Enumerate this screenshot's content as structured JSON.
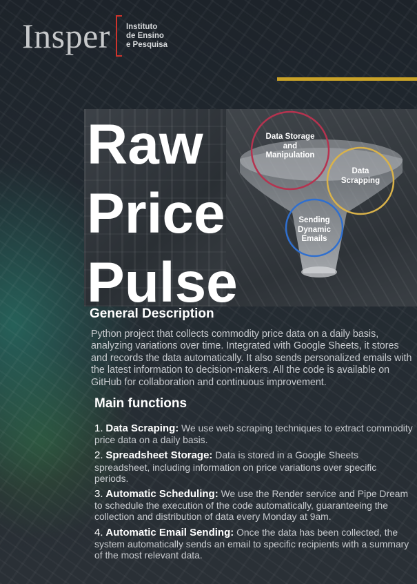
{
  "logo": {
    "wordmark": "Insper",
    "subtitle_line1": "Instituto",
    "subtitle_line2": "de Ensino",
    "subtitle_line3": "e Pesquisa"
  },
  "title": {
    "line1": "Raw",
    "line2": "Price",
    "line3": "Pulse"
  },
  "diagram": {
    "circle1": {
      "line1": "Data Storage",
      "line2": "and",
      "line3": "Manipulation",
      "color": "#b5334f"
    },
    "circle2": {
      "line1": "Data",
      "line2": "Scrapping",
      "color": "#d9b24a"
    },
    "circle3": {
      "line1": "Sending",
      "line2": "Dynamic",
      "line3": "Emails",
      "color": "#2f6fcf"
    }
  },
  "general": {
    "heading": "General Description",
    "line1": "Python project that collects commodity price data on a daily basis,",
    "line2": "analyzing variations over time. Integrated with Google Sheets, it stores",
    "line3": "and records the data automatically. It also sends personalized emails with",
    "line4": "the latest information to decision-makers. All the code is available on",
    "line5": "GitHub for collaboration and continuous improvement."
  },
  "main_functions": {
    "heading": "Main functions",
    "items": [
      {
        "number": "1.",
        "name": "Data Scraping:",
        "text": "We use web scraping techniques to extract commodity price data on a daily basis."
      },
      {
        "number": "2.",
        "name": "Spreadsheet Storage:",
        "text": "Data is stored in a Google Sheets spreadsheet, including information on price variations over specific periods."
      },
      {
        "number": "3.",
        "name": "Automatic Scheduling:",
        "text": "We use the Render service and Pipe Dream to schedule the execution of the code automatically, guaranteeing the collection and distribution of data every Monday at 9am."
      },
      {
        "number": "4.",
        "name": "Automatic Email Sending:",
        "text": "Once the data has been collected, the system automatically sends an email to specific recipients with a summary of the most relevant data."
      }
    ]
  },
  "colors": {
    "accent_gold": "#c9a227",
    "logo_red": "#d0342c",
    "background": "#1e242b"
  }
}
